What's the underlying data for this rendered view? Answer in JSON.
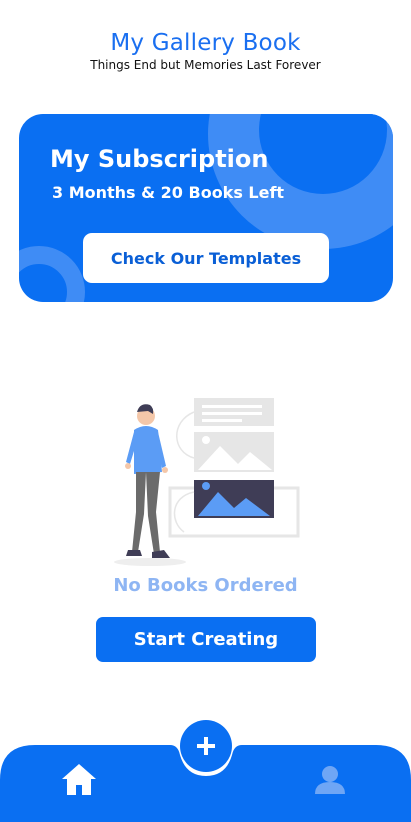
{
  "header": {
    "title": "My Gallery Book",
    "tagline": "Things End but Memories Last Forever"
  },
  "subscription": {
    "title": "My Subscription",
    "detail": "3 Months & 20 Books Left",
    "button_label": "Check Our Templates"
  },
  "empty_state": {
    "illustration": "person-with-gallery-illustration",
    "message": "No Books Ordered"
  },
  "actions": {
    "start_label": "Start Creating"
  },
  "bottom_nav": {
    "items": [
      {
        "icon": "home-icon",
        "active": true
      },
      {
        "icon": "add-icon"
      },
      {
        "icon": "profile-icon",
        "active": false
      }
    ]
  },
  "colors": {
    "primary": "#0a6ff2",
    "primary_light": "#3f8cf5",
    "muted_text": "#8eb5f3"
  }
}
